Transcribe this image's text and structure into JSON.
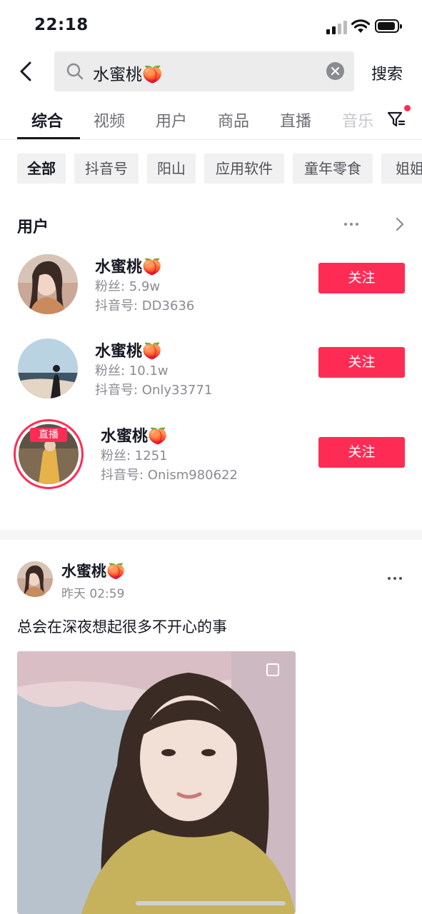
{
  "status_bar": {
    "time": "22:18"
  },
  "search": {
    "query": "水蜜桃🍑",
    "submit_label": "搜索"
  },
  "tabs": [
    {
      "label": "综合",
      "active": true
    },
    {
      "label": "视频"
    },
    {
      "label": "用户"
    },
    {
      "label": "商品"
    },
    {
      "label": "直播"
    },
    {
      "label": "音乐"
    }
  ],
  "chips": [
    {
      "label": "全部",
      "active": true
    },
    {
      "label": "抖音号"
    },
    {
      "label": "阳山"
    },
    {
      "label": "应用软件"
    },
    {
      "label": "童年零食"
    },
    {
      "label": "姐姐"
    }
  ],
  "users_section": {
    "title": "用户",
    "users": [
      {
        "name": "水蜜桃🍑",
        "fans": "粉丝: 5.9w",
        "id": "抖音号: DD3636",
        "follow_label": "关注",
        "live": false
      },
      {
        "name": "水蜜桃🍑",
        "fans": "粉丝: 10.1w",
        "id": "抖音号: Only33771",
        "follow_label": "关注",
        "live": false
      },
      {
        "name": "水蜜桃🍑",
        "fans": "粉丝: 1251",
        "id": "抖音号: Onism980622",
        "follow_label": "关注",
        "live": true,
        "live_label": "直播"
      }
    ]
  },
  "post": {
    "author": "水蜜桃🍑",
    "time": "昨天 02:59",
    "text": "总会在深夜想起很多不开心的事"
  },
  "colors": {
    "accent": "#fe2c55",
    "text": "#161823",
    "muted": "#8a8b91"
  }
}
